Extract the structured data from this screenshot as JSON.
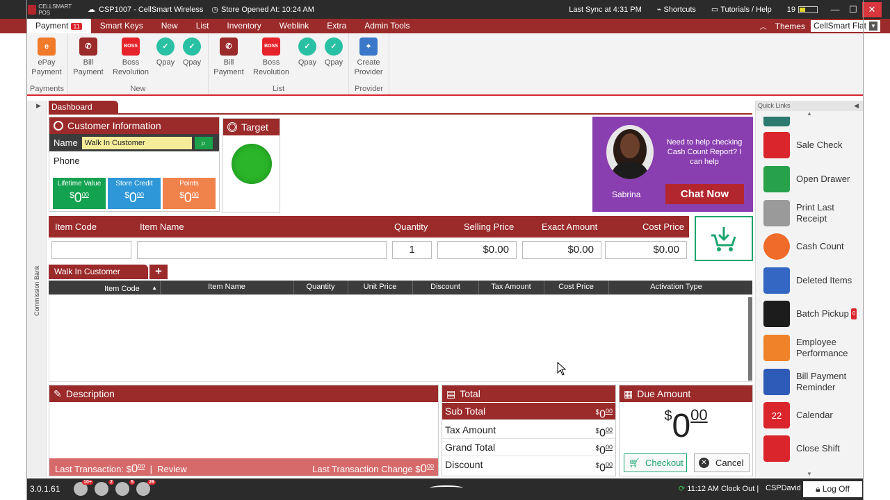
{
  "titlebar": {
    "logo_text": "CELLSMART POS",
    "store": "CSP1007  -  CellSmart Wireless",
    "opened": "Store Opened At: 10:24 AM",
    "last_sync": "Last Sync at 4:31 PM",
    "shortcuts": "Shortcuts",
    "tutorials": "Tutorials / Help",
    "battery": "19"
  },
  "menu": {
    "tabs": [
      "Payment",
      "Smart Keys",
      "New",
      "List",
      "Inventory",
      "Weblink",
      "Extra",
      "Admin Tools"
    ],
    "payment_badge": "11",
    "themes_label": "Themes",
    "theme_value": "CellSmart Flat"
  },
  "ribbon": {
    "groups": {
      "payments": "Payments",
      "new": "New",
      "list": "List",
      "provider": "Provider"
    },
    "buttons": {
      "epay1": "ePay",
      "epay2": "Payment",
      "bill1": "Bill",
      "bill2": "Payment",
      "boss1": "Boss",
      "boss2": "Revolution",
      "qpay": "Qpay",
      "create1": "Create",
      "create2": "Provider"
    }
  },
  "sidebar": {
    "commission": "Commission Bank"
  },
  "dashboard": {
    "tab": "Dashboard"
  },
  "customer": {
    "title": "Customer Information",
    "name_label": "Name",
    "name_value": "Walk In Customer",
    "phone_label": "Phone",
    "lifetime_label": "Lifetime Value",
    "store_credit_label": "Store Credit",
    "points_label": "Points",
    "dollar": "$",
    "zero": "0",
    "cents": "00",
    "colors": {
      "lifetime": "#13a24f",
      "store_credit": "#2e97d8",
      "points": "#f0824c"
    }
  },
  "target": {
    "title": "Target"
  },
  "chat": {
    "message": "Need to help checking Cash Count Report? I can help",
    "agent": "Sabrina",
    "button": "Chat Now"
  },
  "entry": {
    "headers": [
      "Item Code",
      "Item Name",
      "Quantity",
      "Selling Price",
      "Exact Amount",
      "Cost Price"
    ],
    "quantity": "1",
    "selling_price": "$0.00",
    "exact_amount": "$0.00",
    "cost_price": "$0.00"
  },
  "cart": {
    "tab": "Walk In Customer",
    "columns": [
      "Item Code",
      "Item Name",
      "Quantity",
      "Unit Price",
      "Discount",
      "Tax Amount",
      "Cost Price",
      "Activation Type"
    ]
  },
  "description": {
    "title": "Description",
    "last_transaction": "Last Transaction:",
    "review": "Review",
    "last_change": "Last Transaction Change"
  },
  "total": {
    "title": "Total",
    "rows": [
      "Sub Total",
      "Tax Amount",
      "Grand Total",
      "Discount"
    ]
  },
  "due": {
    "title": "Due Amount",
    "checkout": "Checkout",
    "cancel": "Cancel"
  },
  "quick_links": {
    "title": "Quick Links",
    "items": [
      {
        "label": "Sale Check",
        "color": "#d9252b"
      },
      {
        "label": "Open Drawer",
        "color": "#27a24a"
      },
      {
        "label": "Print Last Receipt",
        "color": "#9a9a9a"
      },
      {
        "label": "Cash Count",
        "color": "#f06b2a"
      },
      {
        "label": "Deleted Items",
        "color": "#3467c4"
      },
      {
        "label": "Batch Pickup",
        "color": "#1c1c1c",
        "badge": "0"
      },
      {
        "label": "Employee Performance",
        "color": "#f0822a"
      },
      {
        "label": "Bill Payment Reminder",
        "color": "#2f5bb8"
      },
      {
        "label": "Calendar",
        "color": "#d9252b",
        "day": "22"
      },
      {
        "label": "Close Shift",
        "color": "#d9252b"
      }
    ]
  },
  "statusbar": {
    "version": "3.0.1.61",
    "badges": [
      "10+",
      "2",
      "5",
      "26"
    ],
    "clock": "11:12 AM  Clock Out |",
    "user": "CSPDavid",
    "logoff": "Log Off"
  }
}
